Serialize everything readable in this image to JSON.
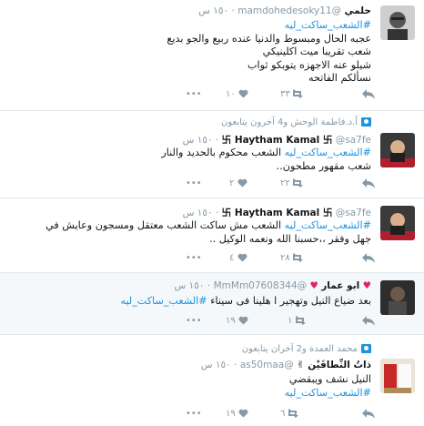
{
  "tweets": [
    {
      "name": "حلمي",
      "handle": "@mamdohedesoky11",
      "time": "١٥٠ س",
      "hashtag": "#الشعب_ساكت_ليه",
      "lines": [
        "عجبه الحال ومبسوط والدنيا عنده ربيع والجو بديع",
        "شعب تقريبا ميت اكلينيكي",
        "شيلو عنه الاجهزه يتوبكو ثواب",
        "نسألكم الفاتحه"
      ],
      "likes": "١٠",
      "retweets": "٣٣",
      "replies": ""
    },
    {
      "context": "أ.د.فاطمة الوحش و4 آخرون يتابعون",
      "name": "卐 Haytham Kamal 卐",
      "handle": "@sa7fe",
      "time": "١٥٠ س",
      "hashtag": "#الشعب_ساكت_ليه",
      "lines": [
        "الشعب محكوم بالحديد والنار",
        "شعب مقهور مطحون.."
      ],
      "likes": "٢",
      "retweets": "٢٢",
      "replies": ""
    },
    {
      "name": "卐 Haytham Kamal 卐",
      "handle": "@sa7fe",
      "time": "١٥٠ س",
      "hashtag": "#الشعب_ساكت_ليه",
      "lines": [
        "الشعب مش ساكت الشعب معتقل ومسجون وعايش في",
        "جهل وفقر ،،حسبنا الله ونعمه الوكيل .."
      ],
      "likes": "٤",
      "retweets": "٢٨",
      "replies": ""
    },
    {
      "name": "ابو عمار",
      "handle": "@MmMm07608344",
      "time": "١٥٠ س",
      "hashtag": "#الشعب_ساكت_ليه",
      "lines": [
        "بعد ضياع النيل وتهجير ا هلينا فى سيناء"
      ],
      "likes": "١٩",
      "retweets": "١",
      "replies": ""
    },
    {
      "context": "محمد العمدة و2 آخران يتابعون",
      "name": "ذاتُ النِّطاقَيْن",
      "handle": "@as50maa",
      "time": "١٥٠ س",
      "hashtag": "#الشعب_ساكت_ليه",
      "lines": [
        "النيل نشف ويبقضي"
      ],
      "likes": "١٩",
      "retweets": "٦",
      "replies": ""
    }
  ]
}
